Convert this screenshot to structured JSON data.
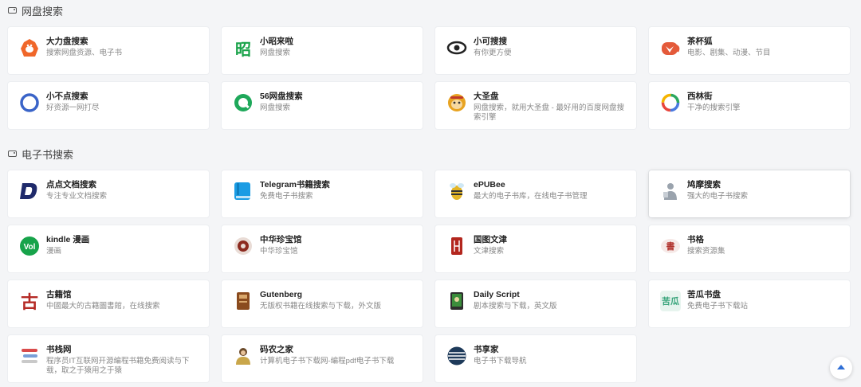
{
  "sections": [
    {
      "title": "网盘搜索",
      "items": [
        {
          "name": "大力盘搜索",
          "desc": "搜索网盘资源、电子书",
          "icon": "gorilla-icon",
          "color": "#f0672a"
        },
        {
          "name": "小昭来啦",
          "desc": "网盘搜索",
          "icon": "zhao-char-icon",
          "color": "#19a34a"
        },
        {
          "name": "小可搜搜",
          "desc": "有你更方便",
          "icon": "eye-icon",
          "color": "#222222"
        },
        {
          "name": "茶杯狐",
          "desc": "电影、剧集、动漫、节目",
          "icon": "fox-icon",
          "color": "#e45a3a"
        },
        {
          "name": "小不点搜索",
          "desc": "好资源一网打尽",
          "icon": "ring-icon",
          "color": "#3a64c8"
        },
        {
          "name": "56网盘搜索",
          "desc": "网盘搜索",
          "icon": "q-circle-icon",
          "color": "#1ea85a"
        },
        {
          "name": "大圣盘",
          "desc": "网盘搜索，就用大圣盘 - 最好用的百度网盘搜索引擎",
          "icon": "monkey-icon",
          "color": "#e8a321"
        },
        {
          "name": "西林街",
          "desc": "干净的搜索引擎",
          "icon": "color-ring-icon",
          "color": "#4a7ae0"
        }
      ]
    },
    {
      "title": "电子书搜索",
      "items": [
        {
          "name": "点点文档搜索",
          "desc": "专注专业文档搜索",
          "icon": "d-letter-icon",
          "color": "#1f2a6b"
        },
        {
          "name": "Telegram书籍搜索",
          "desc": "免费电子书搜索",
          "icon": "telegram-book-icon",
          "color": "#1b9ce4"
        },
        {
          "name": "ePUBee",
          "desc": "最大的电子书库，在线电子书管理",
          "icon": "bee-icon",
          "color": "#e3b527"
        },
        {
          "name": "鸠摩搜索",
          "desc": "强大的电子书搜索",
          "icon": "person-icon",
          "color": "#9aa3ad"
        },
        {
          "name": "kindle 漫画",
          "desc": "漫画",
          "icon": "vol-badge-icon",
          "color": "#17a34a"
        },
        {
          "name": "中华珍宝馆",
          "desc": "中华珍宝馆",
          "icon": "seal-icon",
          "color": "#8c2a1f"
        },
        {
          "name": "国图文津",
          "desc": "文津搜索",
          "icon": "red-seal-icon",
          "color": "#b3261e"
        },
        {
          "name": "书格",
          "desc": "搜索资源集",
          "icon": "shuge-icon",
          "color": "#b0302a"
        },
        {
          "name": "古籍馆",
          "desc": "中國最大的古籍圖書館，在线搜索",
          "icon": "gu-char-icon",
          "color": "#b52a25"
        },
        {
          "name": "Gutenberg",
          "desc": "无版权书籍在线搜索与下载，外文版",
          "icon": "gutenberg-icon",
          "color": "#8a4b1e"
        },
        {
          "name": "Daily Script",
          "desc": "剧本搜索与下载，英文版",
          "icon": "script-icon",
          "color": "#3b8d3b"
        },
        {
          "name": "苦瓜书盘",
          "desc": "免费电子书下载站",
          "icon": "kugua-icon",
          "color": "#3aa57c"
        },
        {
          "name": "书栈网",
          "desc": "程序员IT互联网开源编程书籍免费阅读与下载，取之于猿用之于猿",
          "icon": "book-stack-icon",
          "color": "#d94b4b"
        },
        {
          "name": "码农之家",
          "desc": "计算机电子书下载网-编程pdf电子书下载",
          "icon": "coder-icon",
          "color": "#6b4a2a"
        },
        {
          "name": "书享家",
          "desc": "电子书下载导航",
          "icon": "globe-icon",
          "color": "#1e3a5a"
        }
      ]
    }
  ],
  "back_to_top_icon": "arrow-up-icon"
}
